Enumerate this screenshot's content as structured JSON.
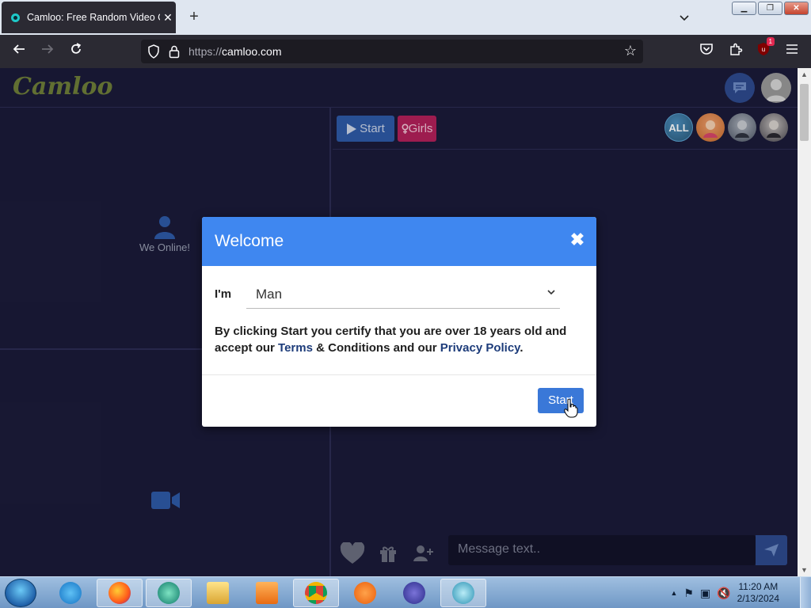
{
  "browser": {
    "tab_title": "Camloo: Free Random Video Chat",
    "url_scheme": "https://",
    "url_host": "camloo.com",
    "extension_badge": "1"
  },
  "site": {
    "logo": "Camloo",
    "we_online": "We Online!",
    "start_button": "Start",
    "girls_button": "Girls",
    "filter_all": "ALL",
    "message_placeholder": "Message text.."
  },
  "modal": {
    "title": "Welcome",
    "close_glyph": "✖",
    "im_label": "I'm",
    "gender_selected": "Man",
    "notice_pre": "By clicking Start you certify that you are over 18 years old and accept our ",
    "terms_link": "Terms",
    "notice_mid": " & Conditions and our ",
    "privacy_link": "Privacy Policy",
    "notice_end": ".",
    "start_button": "Start"
  },
  "taskbar": {
    "time": "11:20 AM",
    "date": "2/13/2024"
  },
  "colors": {
    "modal_header": "#3f87f0",
    "start_button": "#3a78d8",
    "page_bg": "#1b1b3a",
    "girls_button": "#b3205a"
  }
}
